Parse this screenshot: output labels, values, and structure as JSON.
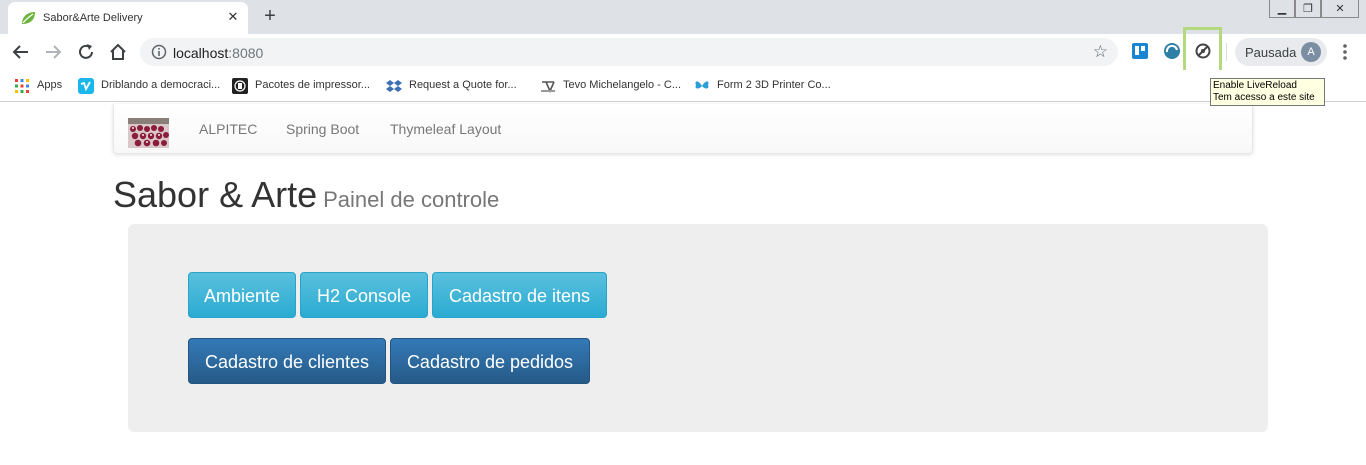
{
  "browser": {
    "tab_title": "Sabor&Arte Delivery",
    "tab_close": "✕",
    "new_tab": "+",
    "url_host": "localhost",
    "url_port": ":8080",
    "profile_label": "Pausada",
    "profile_initial": "A",
    "window_controls": {
      "minimize": "▁",
      "restore": "❐",
      "close": "✕"
    },
    "bookmarks": [
      {
        "label": "Apps",
        "icon": "apps-grid-icon"
      },
      {
        "label": "Driblando a democraci...",
        "icon": "vimeo-icon"
      },
      {
        "label": "Pacotes de impressor...",
        "icon": "printer-package-icon"
      },
      {
        "label": "Request a Quote for...",
        "icon": "dropbox-icon"
      },
      {
        "label": "Tevo Michelangelo - C...",
        "icon": "tevo-icon"
      },
      {
        "label": "Form 2 3D Printer Co...",
        "icon": "butterfly-icon"
      }
    ],
    "tooltip": {
      "line1": "Enable LiveReload",
      "line2": "Tem acesso a este site"
    }
  },
  "navbar": {
    "brand_image": "bakery-image",
    "links": [
      "ALPITEC",
      "Spring Boot",
      "Thymeleaf Layout"
    ]
  },
  "heading": {
    "title": "Sabor & Arte",
    "subtitle": "Painel de controle"
  },
  "buttons": {
    "row1": [
      "Ambiente",
      "H2 Console",
      "Cadastro de itens"
    ],
    "row2": [
      "Cadastro de clientes",
      "Cadastro de pedidos"
    ]
  },
  "colors": {
    "info": "#31b0d5",
    "primary": "#286090",
    "jumbotron": "#eeeeee",
    "highlight": "#b5d97f"
  }
}
